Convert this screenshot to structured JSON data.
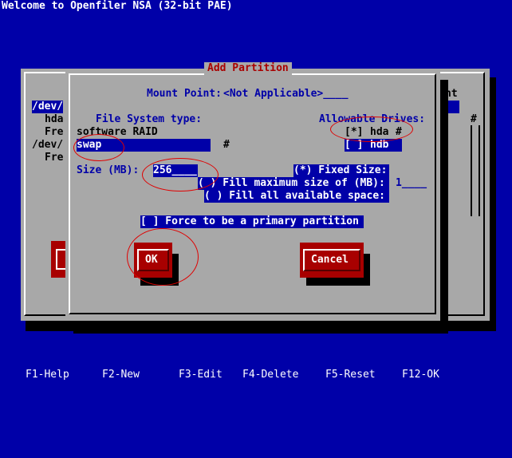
{
  "title": "Welcome to Openfiler NSA (32-bit PAE)",
  "background_window": {
    "left_items": [
      "/dev/",
      "hda",
      "Fre",
      "/dev/",
      "Fre"
    ],
    "right_fragment": "nt"
  },
  "dialog": {
    "title": "Add Partition",
    "mount_point_label": "Mount Point:",
    "mount_point_value": "<Not Applicable>____",
    "fs_type_label": "File System type:",
    "fs_options": [
      "software RAID",
      "swap"
    ],
    "fs_scroll_marker": "#",
    "drives_label": "Allowable Drives:",
    "drives": [
      {
        "checkbox": "[*]",
        "name": "hda",
        "marker": "#"
      },
      {
        "checkbox": "[ ]",
        "name": "hdb",
        "marker": ""
      }
    ],
    "size_label": "Size (MB):",
    "size_value": "256____",
    "fixed_size": "(*) Fixed Size:",
    "fill_max": "( ) Fill maximum size of (MB):",
    "fill_max_value": "1____",
    "fill_all": "( ) Fill all available space:",
    "force_primary": "[ ] Force to be a primary partition",
    "ok_label": "OK",
    "cancel_label": "Cancel"
  },
  "footer": {
    "keys": [
      "F1-Help",
      "F2-New",
      "F3-Edit",
      "F4-Delete",
      "F5-Reset",
      "F12-OK"
    ]
  }
}
